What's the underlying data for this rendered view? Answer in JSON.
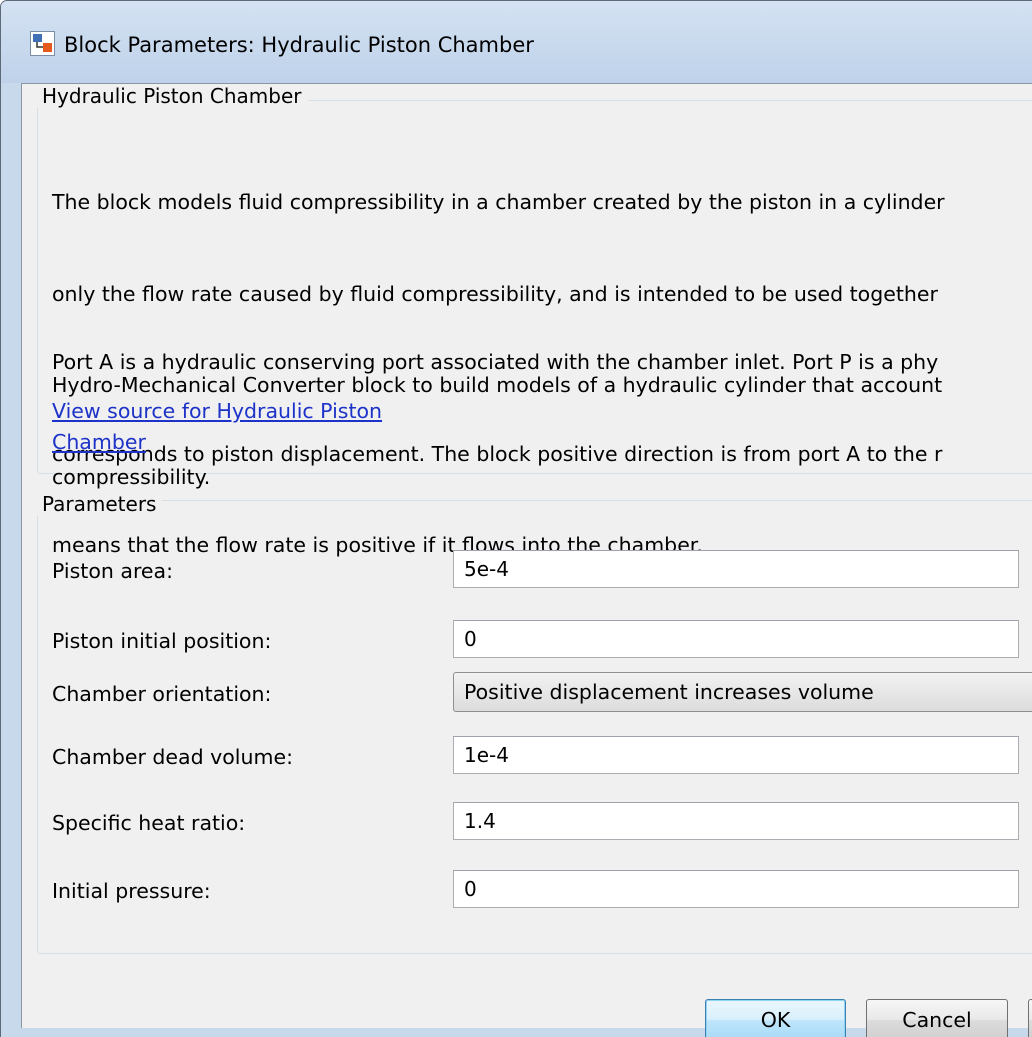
{
  "window": {
    "title": "Block Parameters: Hydraulic Piston Chamber"
  },
  "description": {
    "group_title": "Hydraulic Piston Chamber",
    "paragraph1": [
      "The block models fluid compressibility in a chamber created by the piston in a cylinder",
      "only the flow rate caused by fluid compressibility, and is intended to be used together",
      "Hydro-Mechanical Converter block to build models of a hydraulic cylinder that account",
      "compressibility."
    ],
    "paragraph2": [
      "Port A is a hydraulic conserving port associated with the chamber inlet. Port P is a phy",
      "corresponds to piston displacement. The block positive direction is from port A to the r",
      "means that the flow rate is positive if it flows into the chamber."
    ],
    "link_lines": [
      "View source for Hydraulic Piston",
      "Chamber"
    ]
  },
  "parameters": {
    "group_title": "Parameters",
    "piston_area": {
      "label": "Piston area:",
      "value": "5e-4"
    },
    "piston_initial_position": {
      "label": "Piston initial position:",
      "value": "0"
    },
    "chamber_orientation": {
      "label": "Chamber orientation:",
      "value": "Positive displacement increases volume"
    },
    "chamber_dead_volume": {
      "label": "Chamber dead volume:",
      "value": "1e-4"
    },
    "specific_heat_ratio": {
      "label": "Specific heat ratio:",
      "value": "1.4"
    },
    "initial_pressure": {
      "label": "Initial pressure:",
      "value": "0"
    }
  },
  "buttons": {
    "ok": "OK",
    "cancel": "Cancel"
  },
  "colors": {
    "link": "#1c32c8",
    "frame": "#c9d9ec",
    "client": "#f0f0f0"
  }
}
